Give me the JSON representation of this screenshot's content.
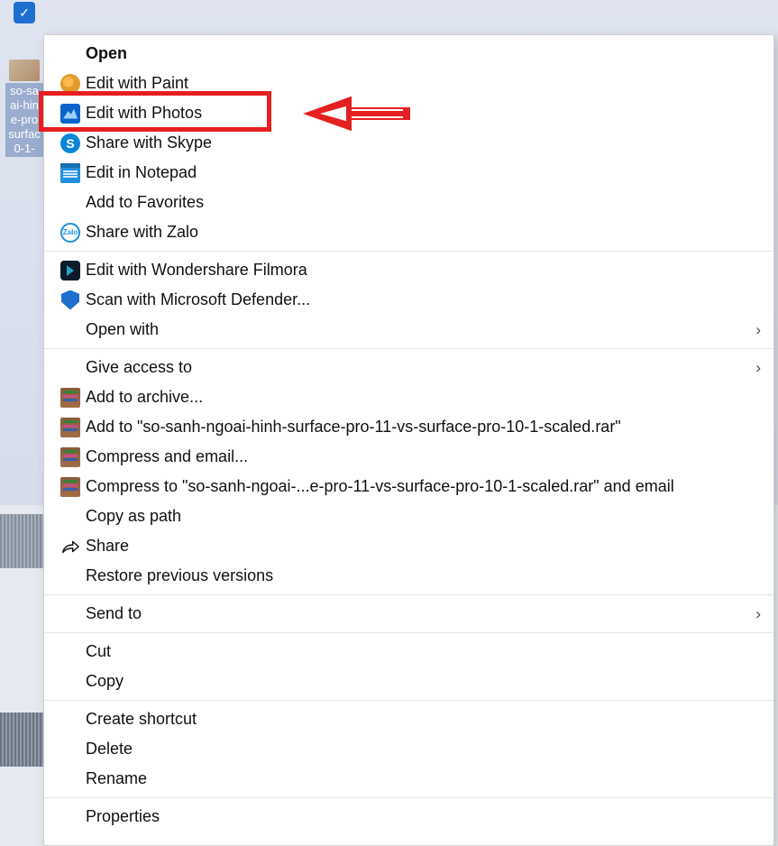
{
  "desktop_icon": {
    "filename_lines": [
      "so-sa",
      "ai-hin",
      "e-pro",
      "surfac",
      "0-1-"
    ]
  },
  "context_menu": {
    "groups": [
      {
        "items": [
          {
            "id": "open",
            "label": "Open",
            "icon": null,
            "bold": true,
            "submenu": false
          },
          {
            "id": "edit-paint",
            "label": "Edit with Paint",
            "icon": "paint",
            "bold": false,
            "submenu": false
          },
          {
            "id": "edit-photos",
            "label": "Edit with Photos",
            "icon": "photos",
            "bold": false,
            "submenu": false,
            "highlighted": true
          },
          {
            "id": "share-skype",
            "label": "Share with Skype",
            "icon": "skype",
            "bold": false,
            "submenu": false
          },
          {
            "id": "edit-notepad",
            "label": "Edit in Notepad",
            "icon": "notepad",
            "bold": false,
            "submenu": false
          },
          {
            "id": "add-favorites",
            "label": "Add to Favorites",
            "icon": null,
            "bold": false,
            "submenu": false
          },
          {
            "id": "share-zalo",
            "label": "Share with Zalo",
            "icon": "zalo",
            "bold": false,
            "submenu": false
          }
        ]
      },
      {
        "items": [
          {
            "id": "edit-filmora",
            "label": "Edit with Wondershare Filmora",
            "icon": "filmora",
            "bold": false,
            "submenu": false
          },
          {
            "id": "scan-defender",
            "label": "Scan with Microsoft Defender...",
            "icon": "defender",
            "bold": false,
            "submenu": false
          },
          {
            "id": "open-with",
            "label": "Open with",
            "icon": null,
            "bold": false,
            "submenu": true
          }
        ]
      },
      {
        "items": [
          {
            "id": "give-access",
            "label": "Give access to",
            "icon": null,
            "bold": false,
            "submenu": true
          },
          {
            "id": "add-archive",
            "label": "Add to archive...",
            "icon": "rar",
            "bold": false,
            "submenu": false
          },
          {
            "id": "add-archive-named",
            "label": "Add to \"so-sanh-ngoai-hinh-surface-pro-11-vs-surface-pro-10-1-scaled.rar\"",
            "icon": "rar",
            "bold": false,
            "submenu": false
          },
          {
            "id": "compress-email",
            "label": "Compress and email...",
            "icon": "rar",
            "bold": false,
            "submenu": false
          },
          {
            "id": "compress-email-named",
            "label": "Compress to \"so-sanh-ngoai-...e-pro-11-vs-surface-pro-10-1-scaled.rar\" and email",
            "icon": "rar",
            "bold": false,
            "submenu": false
          },
          {
            "id": "copy-path",
            "label": "Copy as path",
            "icon": null,
            "bold": false,
            "submenu": false
          },
          {
            "id": "share",
            "label": "Share",
            "icon": "share",
            "bold": false,
            "submenu": false
          },
          {
            "id": "restore-versions",
            "label": "Restore previous versions",
            "icon": null,
            "bold": false,
            "submenu": false
          }
        ]
      },
      {
        "items": [
          {
            "id": "send-to",
            "label": "Send to",
            "icon": null,
            "bold": false,
            "submenu": true
          }
        ]
      },
      {
        "items": [
          {
            "id": "cut",
            "label": "Cut",
            "icon": null,
            "bold": false,
            "submenu": false
          },
          {
            "id": "copy",
            "label": "Copy",
            "icon": null,
            "bold": false,
            "submenu": false
          }
        ]
      },
      {
        "items": [
          {
            "id": "create-shortcut",
            "label": "Create shortcut",
            "icon": null,
            "bold": false,
            "submenu": false
          },
          {
            "id": "delete",
            "label": "Delete",
            "icon": null,
            "bold": false,
            "submenu": false
          },
          {
            "id": "rename",
            "label": "Rename",
            "icon": null,
            "bold": false,
            "submenu": false
          }
        ]
      },
      {
        "items": [
          {
            "id": "properties",
            "label": "Properties",
            "icon": null,
            "bold": false,
            "submenu": false
          }
        ]
      }
    ]
  },
  "annotation": {
    "highlight_target": "edit-photos",
    "arrow_color": "#e62020"
  }
}
